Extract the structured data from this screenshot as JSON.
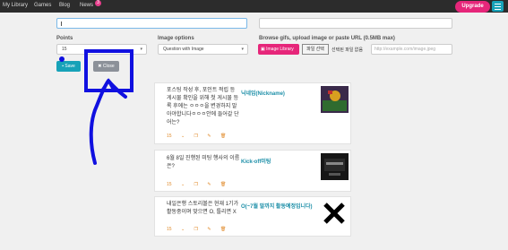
{
  "nav": {
    "links": [
      "My Library",
      "Games",
      "Blog",
      "News"
    ],
    "news_badge": "3",
    "upgrade": "Upgrade"
  },
  "form": {
    "points_label": "Points",
    "points_value": "15",
    "image_options_label": "Image options",
    "image_options_value": "Question with Image",
    "browse_label": "Browse gifs, upload image or paste URL (0.5MB max)",
    "image_library_button": "Image Library",
    "file_button": "파일 선택",
    "file_status": "선택된 파일 없음",
    "url_placeholder": "http://example.com/image.jpeg",
    "save_button": "Save",
    "close_button": "Close"
  },
  "cards": [
    {
      "question": "포스팅 작성 후, 포인트 적립 등 게시물 확인을 위해 첫 게시물 등록 후에는 ㅇㅇㅇ을 변경하지 말아야합니다ㅇㅇㅇ안에 들어갈 단어는?",
      "answer": "닉네임(Nickname)",
      "points": "15",
      "thumb_color": "#3a2a4a"
    },
    {
      "question": "6월 8일 진행된 미팅 행사의 이름은?",
      "answer": "Kick-off미팅",
      "points": "15",
      "thumb_color": "#161616"
    },
    {
      "question": "내일은행 스토리볼은 현재 1기가 활동중이며 맞으면 O, 틀리면 X",
      "answer": "O(~7월 말까지 활동예정입니다)",
      "points": "15",
      "thumb_color": "#ffffff"
    }
  ],
  "colors": {
    "accent": "#17a2b8",
    "brand_pink": "#e6267a",
    "navbar": "#2c2c2c",
    "annotation": "#1010e0"
  }
}
